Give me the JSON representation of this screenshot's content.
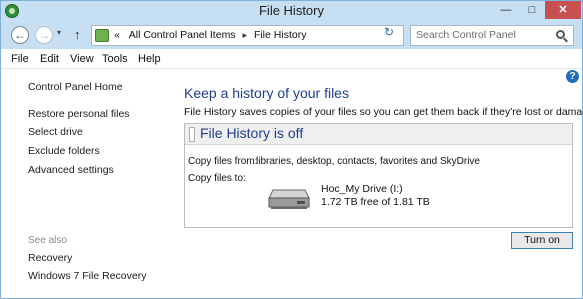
{
  "window": {
    "title": "File History",
    "controls": {
      "minimize": "—",
      "maximize": "□",
      "close": "✕"
    }
  },
  "navigation": {
    "back_glyph": "←",
    "forward_glyph": "→",
    "recent_glyph": "▾",
    "up_glyph": "↑",
    "address": {
      "prefix": "«",
      "crumbs": [
        "All Control Panel Items",
        "File History"
      ],
      "separator": "▸",
      "dropdown_glyph": "▾",
      "refresh_glyph": "↻"
    },
    "search": {
      "placeholder": "Search Control Panel"
    }
  },
  "menu": [
    "File",
    "Edit",
    "View",
    "Tools",
    "Help"
  ],
  "sidebar": {
    "home": "Control Panel Home",
    "links": [
      "Restore personal files",
      "Select drive",
      "Exclude folders",
      "Advanced settings"
    ],
    "see_also_label": "See also",
    "see_also_links": [
      "Recovery",
      "Windows 7 File Recovery"
    ]
  },
  "main": {
    "heading": "Keep a history of your files",
    "description": "File History saves copies of your files so you can get them back if they're lost or damaged.",
    "status": {
      "title": "File History is off",
      "copy_from_label": "Copy files from:",
      "copy_from_value": "libraries, desktop, contacts, favorites and SkyDrive",
      "copy_to_label": "Copy files to:",
      "drive_name": "Hoc_My Drive (I:)",
      "drive_space": "1.72 TB free of 1.81 TB"
    },
    "turn_on_button": "Turn on",
    "help_glyph": "?"
  },
  "colors": {
    "heading": "#1e3f8f",
    "chrome": "#c7dff3",
    "close_button": "#c75050"
  }
}
